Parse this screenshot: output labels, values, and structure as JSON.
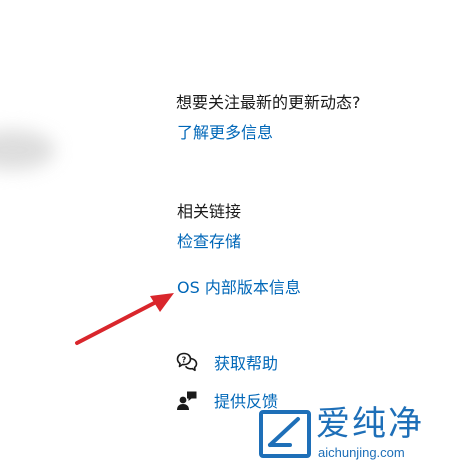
{
  "updates": {
    "heading": "想要关注最新的更新动态?",
    "learn_more_link": "了解更多信息"
  },
  "related": {
    "heading": "相关链接",
    "check_storage_link": "检查存储",
    "os_build_link": "OS 内部版本信息"
  },
  "support": {
    "get_help_label": "获取帮助",
    "feedback_label": "提供反馈",
    "get_help_icon": "chat-help-icon",
    "feedback_icon": "person-feedback-icon"
  },
  "annotation": {
    "arrow_color": "#d9262c"
  },
  "watermark": {
    "title": "爱纯净",
    "url": "aichunjing.com",
    "color": "#1e6fb8"
  },
  "colors": {
    "link": "#0067b8",
    "heading": "#1a1a1a",
    "background": "#ffffff"
  }
}
